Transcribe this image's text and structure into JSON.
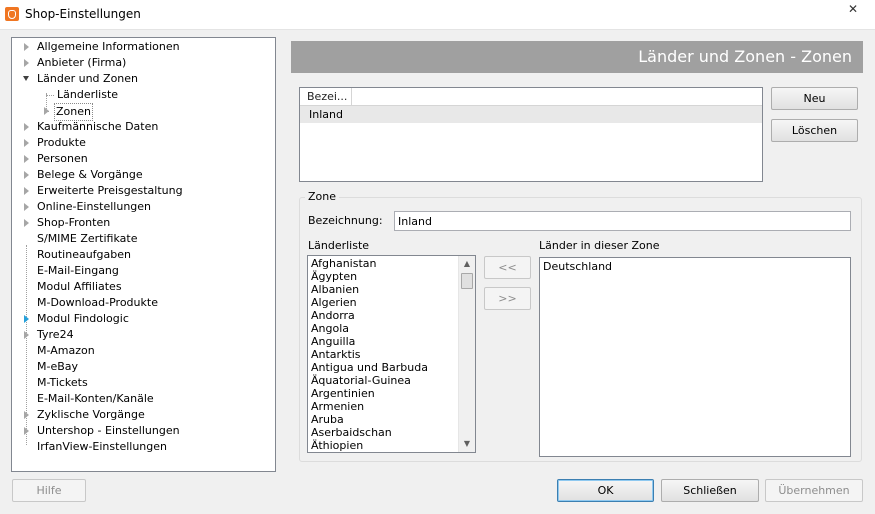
{
  "window": {
    "title": "Shop-Einstellungen",
    "close_label": "✕"
  },
  "tree": {
    "items": [
      {
        "label": "Allgemeine Informationen"
      },
      {
        "label": "Anbieter (Firma)"
      },
      {
        "label": "Länder und Zonen"
      },
      {
        "label": "Länderliste"
      },
      {
        "label": "Zonen"
      },
      {
        "label": "Kaufmännische Daten"
      },
      {
        "label": "Produkte"
      },
      {
        "label": "Personen"
      },
      {
        "label": "Belege & Vorgänge"
      },
      {
        "label": "Erweiterte Preisgestaltung"
      },
      {
        "label": "Online-Einstellungen"
      },
      {
        "label": "Shop-Fronten"
      },
      {
        "label": "S/MIME Zertifikate"
      },
      {
        "label": "Routineaufgaben"
      },
      {
        "label": "E-Mail-Eingang"
      },
      {
        "label": "Modul Affiliates"
      },
      {
        "label": "M-Download-Produkte"
      },
      {
        "label": "Modul Findologic"
      },
      {
        "label": "Tyre24"
      },
      {
        "label": "M-Amazon"
      },
      {
        "label": "M-eBay"
      },
      {
        "label": "M-Tickets"
      },
      {
        "label": "E-Mail-Konten/Kanäle"
      },
      {
        "label": "Zyklische Vorgänge"
      },
      {
        "label": "Untershop - Einstellungen"
      },
      {
        "label": "IrfanView-Einstellungen"
      }
    ]
  },
  "header": {
    "title": "Länder und Zonen - Zonen"
  },
  "zones_grid": {
    "column_header": "Bezei...",
    "rows": [
      {
        "name": "Inland"
      }
    ]
  },
  "actions": {
    "new_label": "Neu",
    "delete_label": "Löschen"
  },
  "zone": {
    "group_label": "Zone",
    "name_label": "Bezeichnung:",
    "name_value": "Inland",
    "countries_label": "Länderliste",
    "zone_countries_label": "Länder in dieser Zone",
    "add_label": "<<",
    "remove_label": ">>",
    "countries": [
      "Afghanistan",
      "Ägypten",
      "Albanien",
      "Algerien",
      "Andorra",
      "Angola",
      "Anguilla",
      "Antarktis",
      "Antigua und Barbuda",
      "Äquatorial-Guinea",
      "Argentinien",
      "Armenien",
      "Aruba",
      "Aserbaidschan",
      "Äthiopien"
    ],
    "zone_countries": [
      "Deutschland"
    ]
  },
  "footer": {
    "help_label": "Hilfe",
    "ok_label": "OK",
    "close_label": "Schließen",
    "apply_label": "Übernehmen"
  },
  "colors": {
    "header_bg": "#a0a0a0",
    "accent_arrow": "#26a0da"
  },
  "icons": {
    "scroll_up": "▲",
    "scroll_down": "▼"
  }
}
